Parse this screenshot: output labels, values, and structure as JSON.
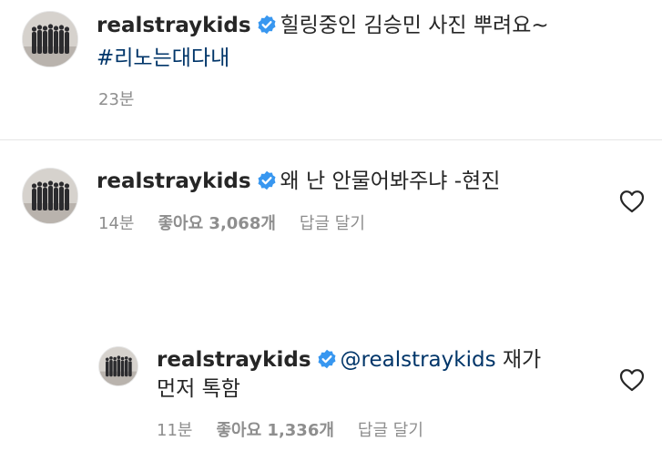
{
  "caption": {
    "username": "realstraykids",
    "text": "힐링중인 김승민 사진 뿌려요~",
    "hashtag": "#리노는대다내",
    "time": "23분"
  },
  "comments": [
    {
      "username": "realstraykids",
      "text": "왜 난 안물어봐주냐 -현진",
      "time": "14분",
      "likes": "좋아요 3,068개",
      "reply_label": "답글 달기"
    }
  ],
  "replies": [
    {
      "username": "realstraykids",
      "mention": "@realstraykids",
      "text_line1": "재가",
      "text_line2": "먼저 톡함",
      "time": "11분",
      "likes": "좋아요 1,336개",
      "reply_label": "답글 달기"
    }
  ],
  "colors": {
    "text": "#262626",
    "meta": "#8e8e8e",
    "hashtag": "#003569",
    "verified": "#3897f0"
  },
  "icons": [
    "verified-badge-icon",
    "heart-icon",
    "avatar"
  ]
}
